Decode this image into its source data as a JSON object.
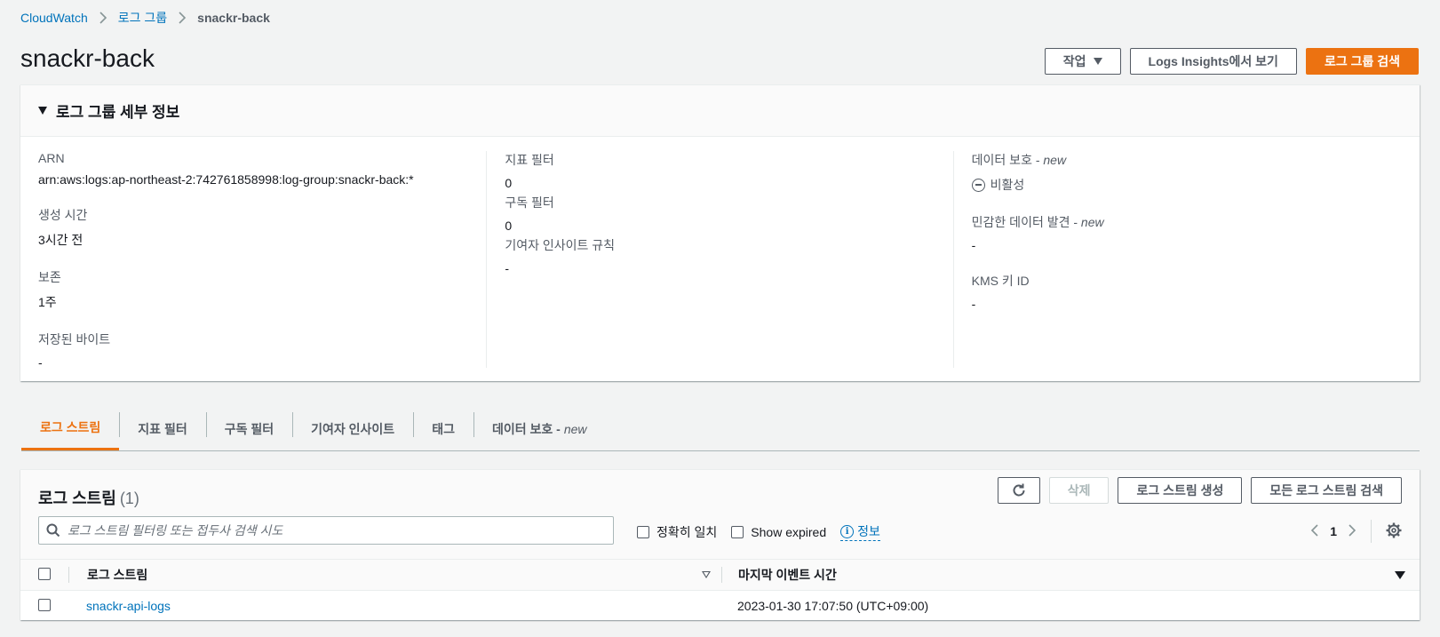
{
  "breadcrumb": {
    "items": [
      "CloudWatch",
      "로그 그룹"
    ],
    "current": "snackr-back"
  },
  "page": {
    "title": "snackr-back"
  },
  "header_actions": {
    "actions_label": "작업",
    "insights_label": "Logs Insights에서 보기",
    "search_label": "로그 그룹 검색"
  },
  "details": {
    "title": "로그 그룹 세부 정보",
    "arn_label": "ARN",
    "arn_value": "arn:aws:logs:ap-northeast-2:742761858998:log-group:snackr-back:*",
    "created_label": "생성 시간",
    "created_value": "3시간 전",
    "retention_label": "보존",
    "retention_value": "1주",
    "stored_label": "저장된 바이트",
    "stored_value": "-",
    "metric_filter_label": "지표 필터",
    "metric_filter_value": "0",
    "subscription_filter_label": "구독 필터",
    "subscription_filter_value": "0",
    "contributor_label": "기여자 인사이트 규칙",
    "contributor_value": "-",
    "data_protection_label": "데이터 보호 - ",
    "data_protection_new": "new",
    "data_protection_value": "비활성",
    "sensitive_label": "민감한 데이터 발견 - ",
    "sensitive_new": "new",
    "sensitive_value": "-",
    "kms_label": "KMS 키 ID",
    "kms_value": "-"
  },
  "tabs": [
    {
      "label": "로그 스트림",
      "active": true
    },
    {
      "label": "지표 필터"
    },
    {
      "label": "구독 필터"
    },
    {
      "label": "기여자 인사이트"
    },
    {
      "label": "태그"
    },
    {
      "label": "데이터 보호 -",
      "suffix": "new"
    }
  ],
  "streams": {
    "title": "로그 스트림",
    "count": "(1)",
    "delete_label": "삭제",
    "create_label": "로그 스트림 생성",
    "search_all_label": "모든 로그 스트림 검색",
    "search_placeholder": "로그 스트림 필터링 또는 접두사 검색 시도",
    "exact_match_label": "정확히 일치",
    "show_expired_label": "Show expired",
    "info_label": "정보",
    "page": "1",
    "col_name": "로그 스트림",
    "col_time": "마지막 이벤트 시간",
    "rows": [
      {
        "name": "snackr-api-logs",
        "time": "2023-01-30 17:07:50 (UTC+09:00)"
      }
    ]
  },
  "colors": {
    "accent": "#ec7211",
    "link": "#0073bb"
  }
}
